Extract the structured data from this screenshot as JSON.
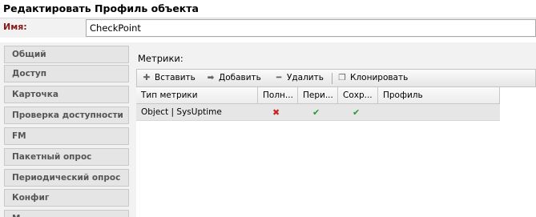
{
  "dialog": {
    "title": "Редактировать Профиль объекта"
  },
  "name_field": {
    "label": "Имя:",
    "value": "CheckPoint"
  },
  "tabs": [
    {
      "label": "Общий"
    },
    {
      "label": "Доступ"
    },
    {
      "label": "Карточка"
    },
    {
      "label": "Проверка доступности"
    },
    {
      "label": "FM"
    },
    {
      "label": "Пакетный опрос"
    },
    {
      "label": "Периодический опрос"
    },
    {
      "label": "Конфиг"
    },
    {
      "label": "М..."
    }
  ],
  "metrics": {
    "label": "Метрики:",
    "toolbar": {
      "insert": "Вставить",
      "add": "Добавить",
      "delete": "Удалить",
      "clone": "Клонировать"
    },
    "columns": [
      "Тип метрики",
      "Полн...",
      "Пери...",
      "Сохр...",
      "Профиль"
    ],
    "rows": [
      {
        "type": "Object | SysUptime",
        "full": "✖",
        "periodic": "✔",
        "saved": "✔",
        "profile": ""
      }
    ]
  },
  "colors": {
    "accent_label": "#8b1a1a",
    "cross": "#cc2222",
    "check": "#2a9a2a"
  }
}
